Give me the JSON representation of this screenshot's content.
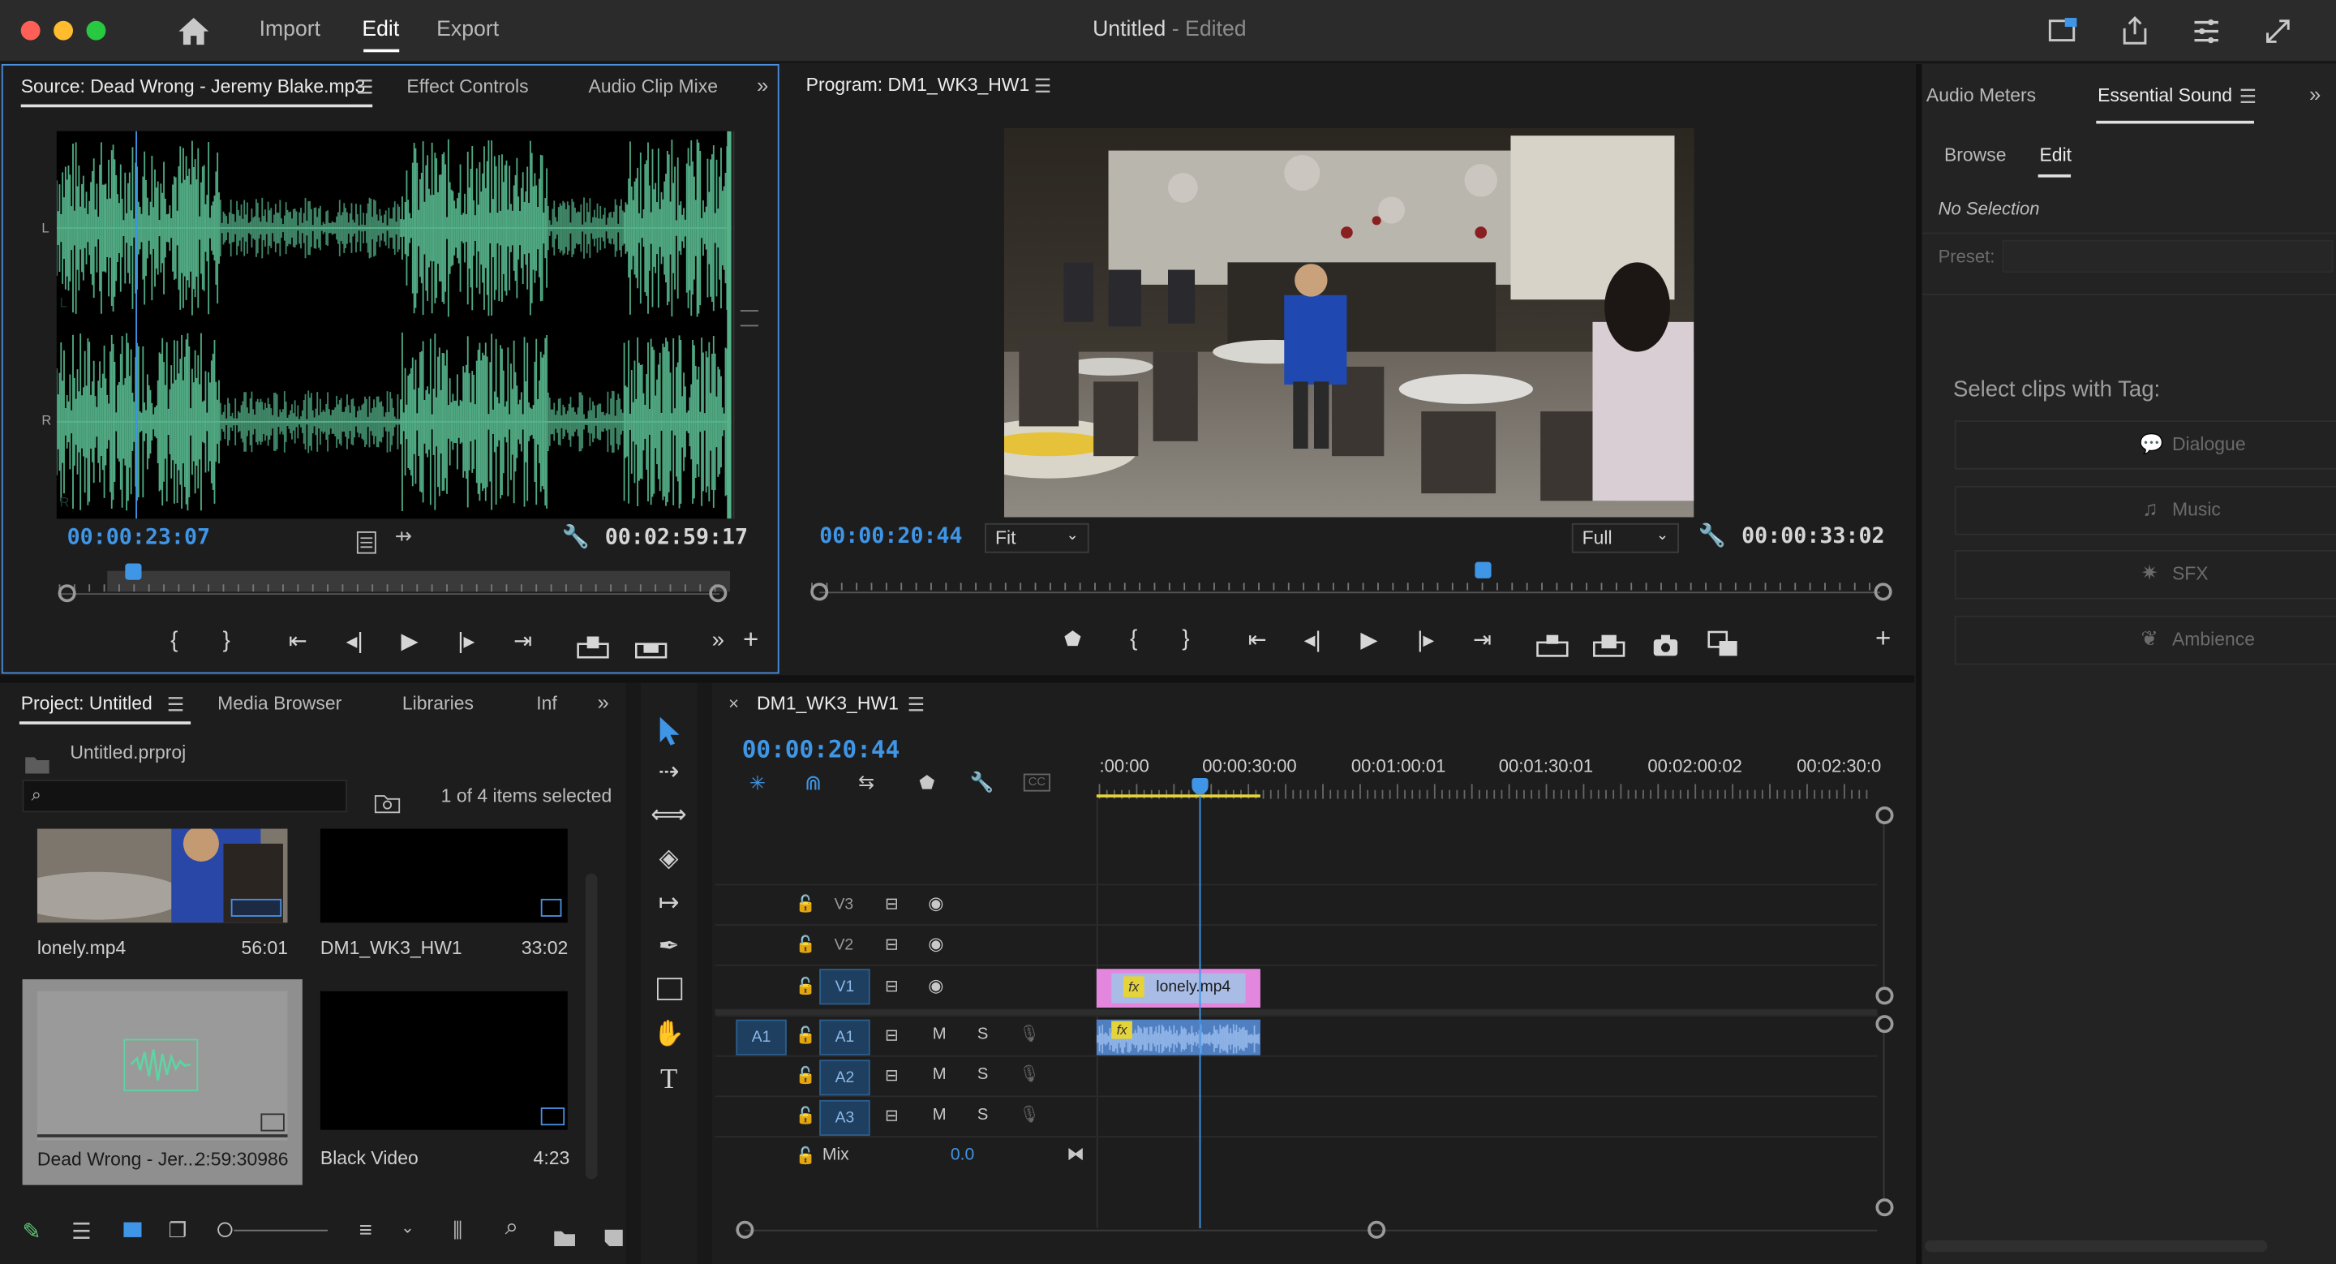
{
  "app": {
    "nav": {
      "home": "home-icon",
      "import": "Import",
      "edit": "Edit",
      "export": "Export"
    },
    "title": "Untitled",
    "title_state": "- Edited",
    "colors": {
      "accent": "#3f95e6",
      "waveform": "#55b38a",
      "panel_bg": "#1d1d1d",
      "focus_border": "#4a8fe0"
    }
  },
  "source": {
    "tabs": [
      "Source: Dead Wrong - Jeremy Blake.mp3",
      "Effect Controls",
      "Audio Clip Mixe"
    ],
    "channel_labels": [
      "L",
      "L",
      "R",
      "R"
    ],
    "timecode_in": "00:00:23:07",
    "timecode_duration": "00:02:59:17"
  },
  "program": {
    "tab": "Program: DM1_WK3_HW1",
    "timecode_in": "00:00:20:44",
    "fit_label": "Fit",
    "full_label": "Full",
    "timecode_duration": "00:00:33:02"
  },
  "essential": {
    "tabs": [
      "Audio Meters",
      "Essential Sound"
    ],
    "subtabs": [
      "Browse",
      "Edit"
    ],
    "no_selection": "No Selection",
    "preset_label": "Preset:",
    "select_heading": "Select clips with Tag:",
    "tags": [
      "Dialogue",
      "Music",
      "SFX",
      "Ambience"
    ]
  },
  "project": {
    "tabs": [
      "Project: Untitled",
      "Media Browser",
      "Libraries",
      "Inf"
    ],
    "file": "Untitled.prproj",
    "search_placeholder": "",
    "selection_count": "1 of 4 items selected",
    "items": [
      {
        "name": "lonely.mp4",
        "duration": "56:01"
      },
      {
        "name": "DM1_WK3_HW1",
        "duration": "33:02"
      },
      {
        "name": "Dead Wrong - Jer...",
        "duration": "2:59:30986"
      },
      {
        "name": "Black Video",
        "duration": "4:23"
      }
    ]
  },
  "timeline": {
    "tab": "DM1_WK3_HW1",
    "timecode": "00:00:20:44",
    "ruler": [
      ":00:00",
      "00:00:30:00",
      "00:01:00:01",
      "00:01:30:01",
      "00:02:00:02",
      "00:02:30:0"
    ],
    "video_tracks": [
      "V3",
      "V2",
      "V1"
    ],
    "audio_tracks": [
      "A1",
      "A2",
      "A3"
    ],
    "source_patch": "A1",
    "mix_label": "Mix",
    "mix_value": "0.0",
    "clip_video": "lonely.mp4",
    "fx_badge": "fx",
    "mute_label": "M",
    "solo_label": "S"
  }
}
